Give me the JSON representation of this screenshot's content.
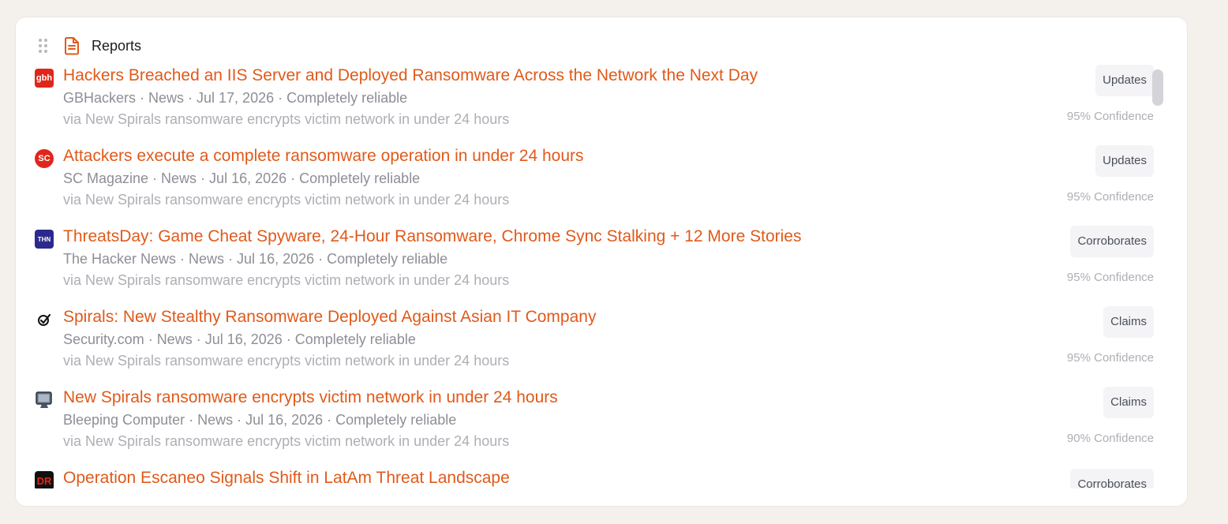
{
  "panel": {
    "title": "Reports",
    "items": [
      {
        "title": "Hackers Breached an IIS Server and Deployed Ransomware Across the Network the Next Day",
        "meta": "GBHackers · News · Jul 17, 2026 · Completely reliable",
        "via": "via New Spirals ransomware encrypts victim network in under 24 hours",
        "badge": "Updates",
        "confidence": "95% Confidence",
        "favicon_label": "gbh",
        "favicon_color": "#e0261b"
      },
      {
        "title": "Attackers execute a complete ransomware operation in under 24 hours",
        "meta": "SC Magazine · News · Jul 16, 2026 · Completely reliable",
        "via": "via New Spirals ransomware encrypts victim network in under 24 hours",
        "badge": "Updates",
        "confidence": "95% Confidence",
        "favicon_label": "SC",
        "favicon_color": "#e0261b"
      },
      {
        "title": "ThreatsDay: Game Cheat Spyware, 24-Hour Ransomware, Chrome Sync Stalking + 12 More Stories",
        "meta": "The Hacker News · News · Jul 16, 2026 · Completely reliable",
        "via": "via New Spirals ransomware encrypts victim network in under 24 hours",
        "badge": "Corroborates",
        "confidence": "95% Confidence",
        "favicon_label": "THN",
        "favicon_color": "#2b2a8c"
      },
      {
        "title": "Spirals: New Stealthy Ransomware Deployed Against Asian IT Company",
        "meta": "Security.com · News · Jul 16, 2026 · Completely reliable",
        "via": "via New Spirals ransomware encrypts victim network in under 24 hours",
        "badge": "Claims",
        "confidence": "95% Confidence",
        "favicon_label": "",
        "favicon_color": "#ffffff"
      },
      {
        "title": "New Spirals ransomware encrypts victim network in under 24 hours",
        "meta": "Bleeping Computer · News · Jul 16, 2026 · Completely reliable",
        "via": "via New Spirals ransomware encrypts victim network in under 24 hours",
        "badge": "Claims",
        "confidence": "90% Confidence",
        "favicon_label": "",
        "favicon_color": "#ffffff"
      },
      {
        "title": "Operation Escaneo Signals Shift in LatAm Threat Landscape",
        "meta": "",
        "via": "",
        "badge": "Corroborates",
        "confidence": "",
        "favicon_label": "DR",
        "favicon_color": "#111111"
      }
    ]
  },
  "colors": {
    "accent": "#e05a1a",
    "background": "#f4f0ec"
  },
  "icons": {
    "drag": "drag-handle-icon",
    "header": "document-icon"
  }
}
